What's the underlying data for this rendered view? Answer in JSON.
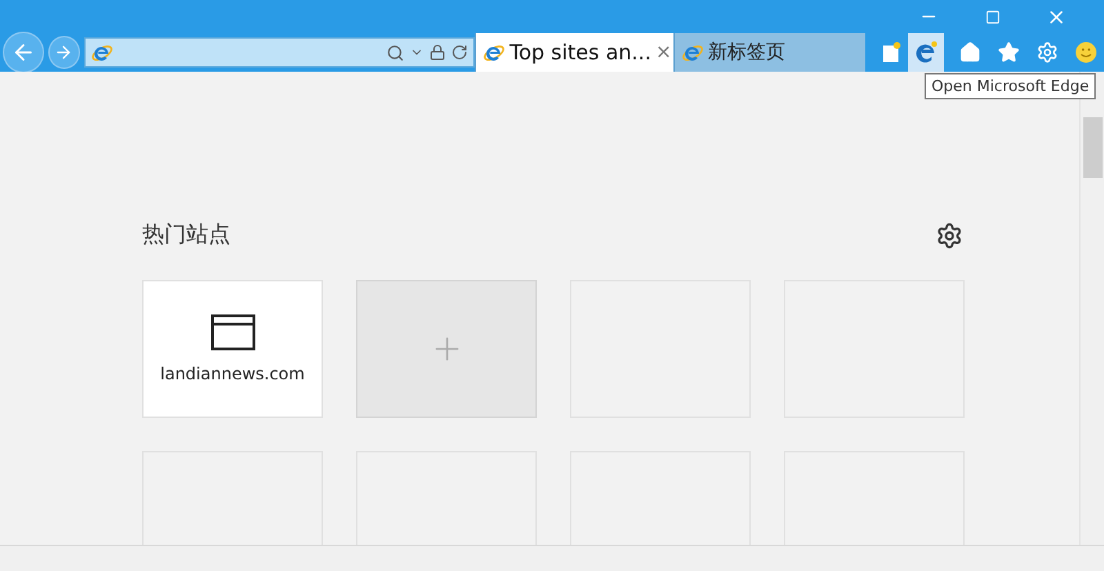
{
  "tabs": [
    {
      "title": "Top sites an...",
      "selected": true,
      "close": "×"
    },
    {
      "title": "新标签页",
      "selected": false
    }
  ],
  "edge_button": {
    "hovered": true,
    "tooltip": "Open Microsoft Edge"
  },
  "top_sites": {
    "title": "热门站点",
    "tiles": [
      {
        "kind": "site",
        "label": "landiannews.com"
      },
      {
        "kind": "add"
      },
      {
        "kind": "empty"
      },
      {
        "kind": "empty"
      },
      {
        "kind": "empty"
      },
      {
        "kind": "empty"
      },
      {
        "kind": "empty"
      },
      {
        "kind": "empty"
      }
    ]
  }
}
